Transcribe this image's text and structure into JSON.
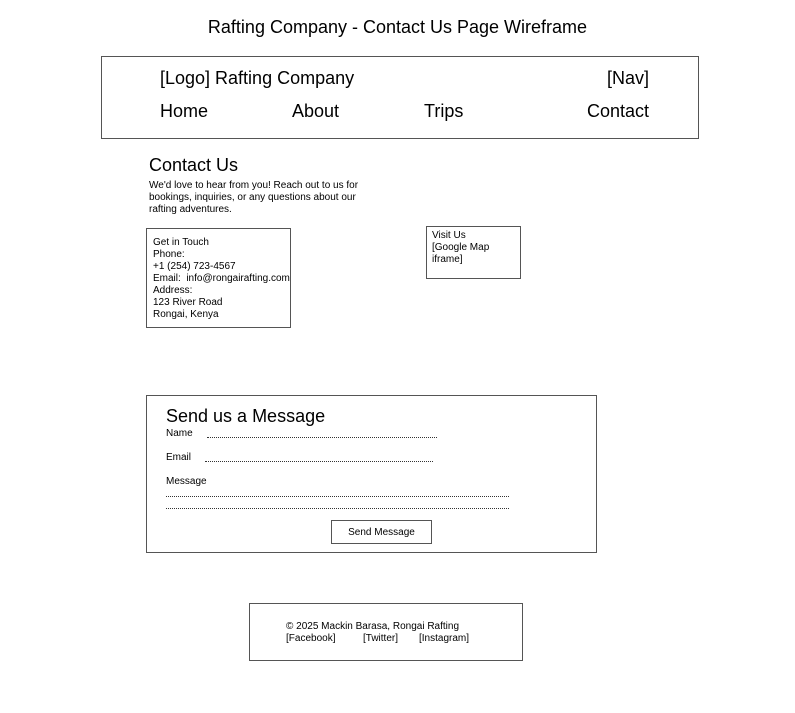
{
  "title": "Rafting Company - Contact Us Page Wireframe",
  "header": {
    "logo": "[Logo] Rafting Company",
    "nav_placeholder": "[Nav]",
    "nav": [
      "Home",
      "About",
      "Trips",
      "Contact"
    ]
  },
  "intro": {
    "heading": "Contact Us",
    "text_lines": [
      "We'd love to hear from you! Reach out to us for",
      "bookings, inquiries, or any questions about our",
      "rafting adventures."
    ]
  },
  "contact_card": {
    "lines": [
      "Get in Touch",
      "Phone:",
      "+1 (254) 723-4567",
      "Email:  info@rongairafting.com",
      "Address:",
      "123 River Road",
      "Rongai, Kenya"
    ]
  },
  "map_card": {
    "lines": [
      "Visit Us",
      "[Google Map iframe]"
    ]
  },
  "form": {
    "heading": "Send us a Message",
    "name_label": "Name",
    "email_label": "Email",
    "message_label": "Message",
    "submit_label": "Send Message"
  },
  "footer": {
    "copyright": "© 2025 Mackin Barasa, Rongai Rafting",
    "links": [
      "[Facebook]",
      "[Twitter]",
      "[Instagram]"
    ]
  }
}
